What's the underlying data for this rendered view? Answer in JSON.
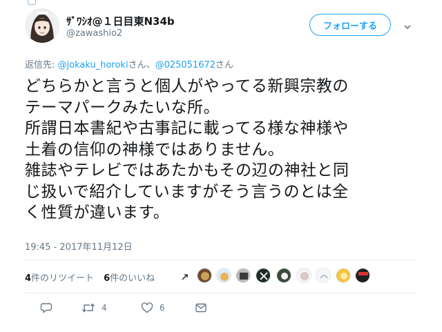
{
  "header": {
    "display_name": "ｻﾞﾜｼｵ@１日目東N34b",
    "handle": "@zawashio2",
    "follow_label": "フォローする"
  },
  "reply": {
    "prefix": "返信先: ",
    "user1": "@jokaku_horoki",
    "sep1": "さん、",
    "user2": "@025051672",
    "sep2": "さん"
  },
  "tweet": {
    "lines": [
      "どちらかと言うと個人がやってる新興宗教の",
      "テーマパークみたいな所。",
      "所謂日本書紀や古事記に載ってる様な神様や",
      "土着の信仰の神様ではありません。",
      "雑誌やテレビではあたかもその辺の神社と同",
      "じ扱いで紹介していますがそう言うのとは全",
      "く性質が違います。"
    ],
    "timestamp": "19:45 - 2017年11月12日"
  },
  "stats": {
    "retweet_count": "4",
    "retweet_label": "件のリツイート",
    "like_count": "6",
    "like_label": "件のいいね"
  },
  "actions": {
    "reply_icon": "reply-icon",
    "retweet_icon": "retweet-icon",
    "retweet_count": "4",
    "like_icon": "heart-icon",
    "like_count": "6",
    "dm_icon": "envelope-icon"
  },
  "colors": {
    "accent": "#1da1f2",
    "muted": "#657786",
    "text": "#14171a",
    "divider": "#e6ecf0"
  }
}
